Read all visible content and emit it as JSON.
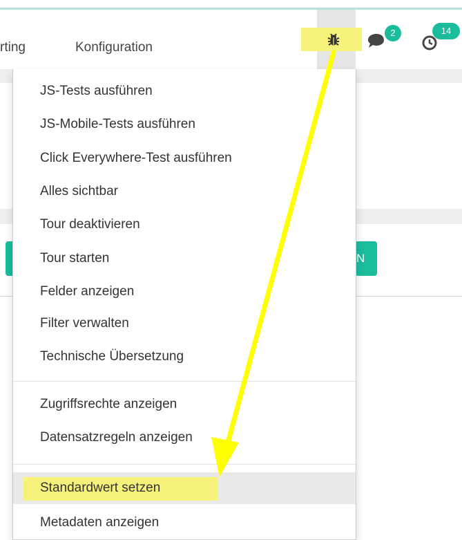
{
  "navbar": {
    "menu_reporting": "rting",
    "menu_configuration": "Konfiguration",
    "chat_badge": "2",
    "activity_badge": "14"
  },
  "partial_button": "N",
  "debug_menu": {
    "groups": [
      [
        "JS-Tests ausführen",
        "JS-Mobile-Tests ausführen",
        "Click Everywhere-Test ausführen",
        "Alles sichtbar",
        "Tour deaktivieren",
        "Tour starten",
        "Felder anzeigen",
        "Filter verwalten",
        "Technische Übersetzung"
      ],
      [
        "Zugriffsrechte anzeigen",
        "Datensatzregeln anzeigen"
      ],
      [
        "Standardwert setzen",
        "Metadaten anzeigen"
      ]
    ],
    "highlighted_item": "Standardwert setzen"
  },
  "colors": {
    "accent": "#1abc9c",
    "annotation": "#ffff00",
    "highlight": "#f7f37a"
  },
  "icons": {
    "debug": "bug-icon",
    "chat": "chat-bubbles-icon",
    "activity": "clock-icon"
  }
}
